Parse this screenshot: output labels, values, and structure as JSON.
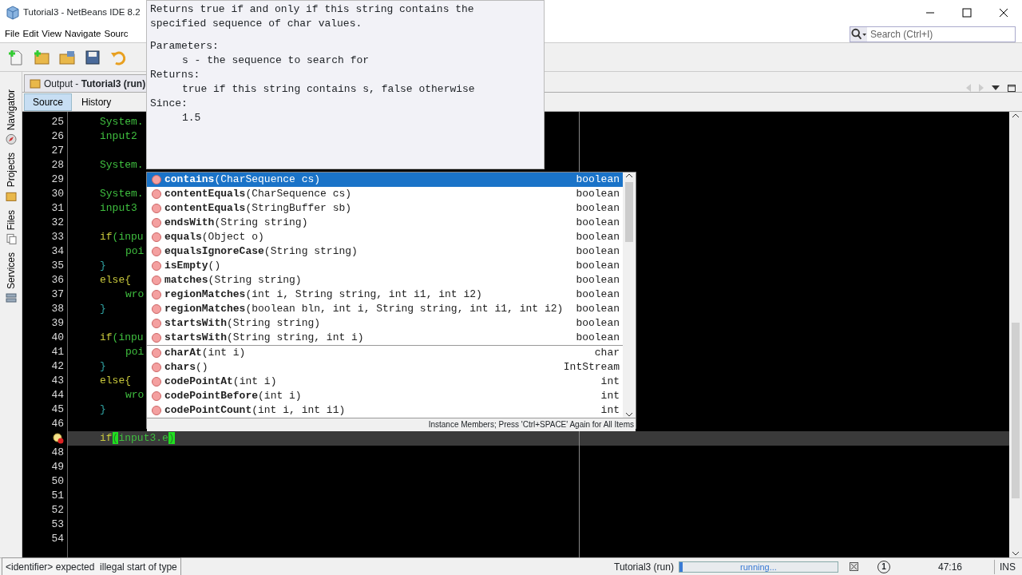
{
  "window": {
    "title": "Tutorial3 - NetBeans IDE 8.2"
  },
  "menu": [
    "File",
    "Edit",
    "View",
    "Navigate",
    "Sourc"
  ],
  "search": {
    "placeholder": "Search (Ctrl+I)"
  },
  "side_tabs": [
    {
      "label": "Navigator"
    },
    {
      "label": "Projects"
    },
    {
      "label": "Files"
    },
    {
      "label": "Services"
    }
  ],
  "editor_tab": {
    "label": "Output - **Tutorial3 (run)**"
  },
  "editor_toolbar": [
    {
      "label": "Source",
      "selected": true
    },
    {
      "label": "History",
      "selected": false
    }
  ],
  "code_lines": [
    {
      "number": "25",
      "current": false,
      "error": false,
      "inner": false,
      "tokens": [
        {
          "text": "System.",
          "kind": "ident"
        }
      ]
    },
    {
      "number": "26",
      "current": false,
      "error": false,
      "inner": false,
      "tokens": [
        {
          "text": "input2",
          "kind": "ident"
        }
      ]
    },
    {
      "number": "27",
      "current": false,
      "error": false
    },
    {
      "number": "28",
      "current": false,
      "error": false,
      "inner": false,
      "tokens": [
        {
          "text": "System.",
          "kind": "ident"
        }
      ]
    },
    {
      "number": "29",
      "current": false,
      "error": false
    },
    {
      "number": "30",
      "current": false,
      "error": false,
      "inner": false,
      "tokens": [
        {
          "text": "System.",
          "kind": "ident"
        }
      ]
    },
    {
      "number": "31",
      "current": false,
      "error": false,
      "inner": false,
      "tokens": [
        {
          "text": "input3",
          "kind": "ident"
        }
      ]
    },
    {
      "number": "32",
      "current": false,
      "error": false
    },
    {
      "number": "33",
      "current": false,
      "error": false,
      "inner": false,
      "tokens": [
        {
          "text": "if",
          "kind": "keyword"
        },
        {
          "text": "(inpu",
          "kind": "ident"
        }
      ]
    },
    {
      "number": "34",
      "current": false,
      "error": false,
      "inner": true,
      "tokens": [
        {
          "text": "poi",
          "kind": "ident"
        }
      ]
    },
    {
      "number": "35",
      "current": false,
      "error": false,
      "inner": false,
      "tokens": [
        {
          "text": "}",
          "kind": "brace"
        }
      ]
    },
    {
      "number": "36",
      "current": false,
      "error": false,
      "inner": false,
      "tokens": [
        {
          "text": "else{",
          "kind": "keyword"
        }
      ]
    },
    {
      "number": "37",
      "current": false,
      "error": false,
      "inner": true,
      "tokens": [
        {
          "text": "wro",
          "kind": "ident"
        }
      ]
    },
    {
      "number": "38",
      "current": false,
      "error": false,
      "inner": false,
      "tokens": [
        {
          "text": "}",
          "kind": "brace"
        }
      ]
    },
    {
      "number": "39",
      "current": false,
      "error": false
    },
    {
      "number": "40",
      "current": false,
      "error": false,
      "inner": false,
      "tokens": [
        {
          "text": "if",
          "kind": "keyword"
        },
        {
          "text": "(inpu",
          "kind": "ident"
        }
      ]
    },
    {
      "number": "41",
      "current": false,
      "error": false,
      "inner": true,
      "tokens": [
        {
          "text": "poi",
          "kind": "ident"
        }
      ]
    },
    {
      "number": "42",
      "current": false,
      "error": false,
      "inner": false,
      "tokens": [
        {
          "text": "}",
          "kind": "brace"
        }
      ]
    },
    {
      "number": "43",
      "current": false,
      "error": false,
      "inner": false,
      "tokens": [
        {
          "text": "else{",
          "kind": "keyword"
        }
      ]
    },
    {
      "number": "44",
      "current": false,
      "error": false,
      "inner": true,
      "tokens": [
        {
          "text": "wro",
          "kind": "ident"
        }
      ]
    },
    {
      "number": "45",
      "current": false,
      "error": false,
      "inner": false,
      "tokens": [
        {
          "text": "}",
          "kind": "brace"
        }
      ]
    },
    {
      "number": "46",
      "current": false,
      "error": false
    },
    {
      "current": true,
      "error": true,
      "inner": false,
      "tokens": [
        {
          "text": "if",
          "kind": "keyword"
        },
        {
          "text": "(",
          "kind": "match"
        },
        {
          "text": "input3.e",
          "kind": "ident"
        },
        {
          "text": ")",
          "kind": "match"
        }
      ]
    },
    {
      "number": "48",
      "current": false,
      "error": false
    },
    {
      "number": "49",
      "current": false,
      "error": false
    },
    {
      "number": "50",
      "current": false,
      "error": false
    },
    {
      "number": "51",
      "current": false,
      "error": false
    },
    {
      "number": "52",
      "current": false,
      "error": false
    },
    {
      "number": "53",
      "current": false,
      "error": false
    },
    {
      "number": "54",
      "current": false,
      "error": false
    }
  ],
  "javadoc": {
    "summary": [
      "Returns true if and only if this string contains the",
      "specified sequence of char values."
    ],
    "sections": [
      {
        "heading": "Parameters:",
        "body": "s - the sequence to search for"
      },
      {
        "heading": "Returns:",
        "body": "true if this string contains s, false otherwise"
      },
      {
        "heading": "Since:",
        "body": "1.5"
      }
    ]
  },
  "completion": {
    "groups": [
      {
        "items": [
          {
            "method": "contains",
            "signature": "(CharSequence cs)",
            "returns": "boolean",
            "selected": true
          },
          {
            "method": "contentEquals",
            "signature": "(CharSequence cs)",
            "returns": "boolean",
            "selected": false
          },
          {
            "method": "contentEquals",
            "signature": "(StringBuffer sb)",
            "returns": "boolean",
            "selected": false
          },
          {
            "method": "endsWith",
            "signature": "(String string)",
            "returns": "boolean",
            "selected": false
          },
          {
            "method": "equals",
            "signature": "(Object o)",
            "returns": "boolean",
            "selected": false
          },
          {
            "method": "equalsIgnoreCase",
            "signature": "(String string)",
            "returns": "boolean",
            "selected": false
          },
          {
            "method": "isEmpty",
            "signature": "()",
            "returns": "boolean",
            "selected": false
          },
          {
            "method": "matches",
            "signature": "(String string)",
            "returns": "boolean",
            "selected": false
          },
          {
            "method": "regionMatches",
            "signature": "(int i, String string, int i1, int i2)",
            "returns": "boolean",
            "selected": false
          },
          {
            "method": "regionMatches",
            "signature": "(boolean bln, int i, String string, int i1, int i2)",
            "returns": "boolean",
            "selected": false
          },
          {
            "method": "startsWith",
            "signature": "(String string)",
            "returns": "boolean",
            "selected": false
          },
          {
            "method": "startsWith",
            "signature": "(String string, int i)",
            "returns": "boolean",
            "selected": false
          }
        ]
      },
      {
        "items": [
          {
            "method": "charAt",
            "signature": "(int i)",
            "returns": "char",
            "selected": false
          },
          {
            "method": "chars",
            "signature": "()",
            "returns": "IntStream",
            "selected": false
          },
          {
            "method": "codePointAt",
            "signature": "(int i)",
            "returns": "int",
            "selected": false
          },
          {
            "method": "codePointBefore",
            "signature": "(int i)",
            "returns": "int",
            "selected": false
          },
          {
            "method": "codePointCount",
            "signature": "(int i, int i1)",
            "returns": "int",
            "selected": false
          }
        ]
      }
    ],
    "footer": "Instance Members; Press 'Ctrl+SPACE' Again for All Items"
  },
  "status_bar": {
    "message": "<identifier> expected  illegal start of type",
    "task": "Tutorial3 (run)",
    "progress": "running...",
    "level": 0.02,
    "notifications": "1",
    "position": "47:16",
    "mode": "INS"
  }
}
